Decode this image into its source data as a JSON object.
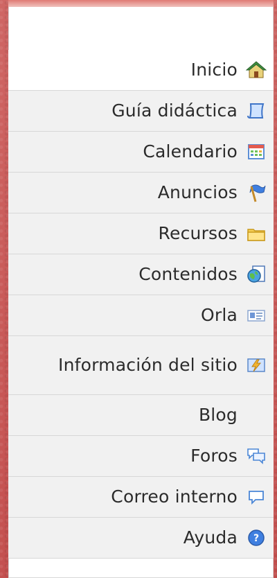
{
  "menu": {
    "items": [
      {
        "label": "Inicio",
        "icon": "home-icon"
      },
      {
        "label": "Guía didáctica",
        "icon": "scroll-icon"
      },
      {
        "label": "Calendario",
        "icon": "calendar-icon"
      },
      {
        "label": "Anuncios",
        "icon": "flag-icon"
      },
      {
        "label": "Recursos",
        "icon": "folder-icon"
      },
      {
        "label": "Contenidos",
        "icon": "globe-document-icon"
      },
      {
        "label": "Orla",
        "icon": "id-card-icon"
      },
      {
        "label": "Información del sitio",
        "icon": "site-info-icon"
      },
      {
        "label": "Blog",
        "icon": ""
      },
      {
        "label": "Foros",
        "icon": "chat-bubbles-icon"
      },
      {
        "label": "Correo interno",
        "icon": "speech-bubble-icon"
      },
      {
        "label": "Ayuda",
        "icon": "help-icon"
      }
    ]
  },
  "colors": {
    "background": "#c95a58",
    "panel": "#ffffff",
    "row": "#f1f1f1",
    "divider": "#d7d7d7",
    "text": "#2b2b2b"
  }
}
